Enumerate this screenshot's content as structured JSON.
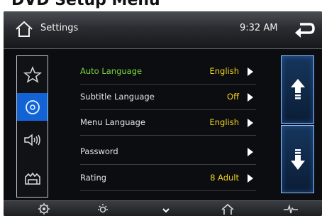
{
  "page_heading": "DVD Setup Menu",
  "topbar": {
    "title": "Settings",
    "time": "9:32 AM"
  },
  "sidebar": {
    "items": [
      {
        "icon": "star-icon",
        "active": false
      },
      {
        "icon": "disc-icon",
        "active": true
      },
      {
        "icon": "speaker-icon",
        "active": false
      },
      {
        "icon": "car-icon",
        "active": false
      }
    ]
  },
  "settings": {
    "rows": [
      {
        "label": "Auto Language",
        "value": "English",
        "highlighted": true
      },
      {
        "label": "Subtitle Language",
        "value": "Off",
        "highlighted": false
      },
      {
        "label": "Menu Language",
        "value": "English",
        "highlighted": false
      },
      {
        "label": "Password",
        "value": "",
        "highlighted": false
      },
      {
        "label": "Rating",
        "value": "8 Adult",
        "highlighted": false
      }
    ]
  },
  "scroll": {
    "up_icon": "arrow-up-icon",
    "down_icon": "arrow-down-icon"
  },
  "bottombar": {
    "icons": [
      "gear-icon",
      "brightness-icon",
      "chevron-down-icon",
      "home-icon",
      "waveform-icon"
    ]
  },
  "colors": {
    "accent_blue": "#1264d6",
    "highlight_green": "#7bd63b",
    "value_yellow": "#f2d21c",
    "scroll_border": "#8fc2ff"
  }
}
